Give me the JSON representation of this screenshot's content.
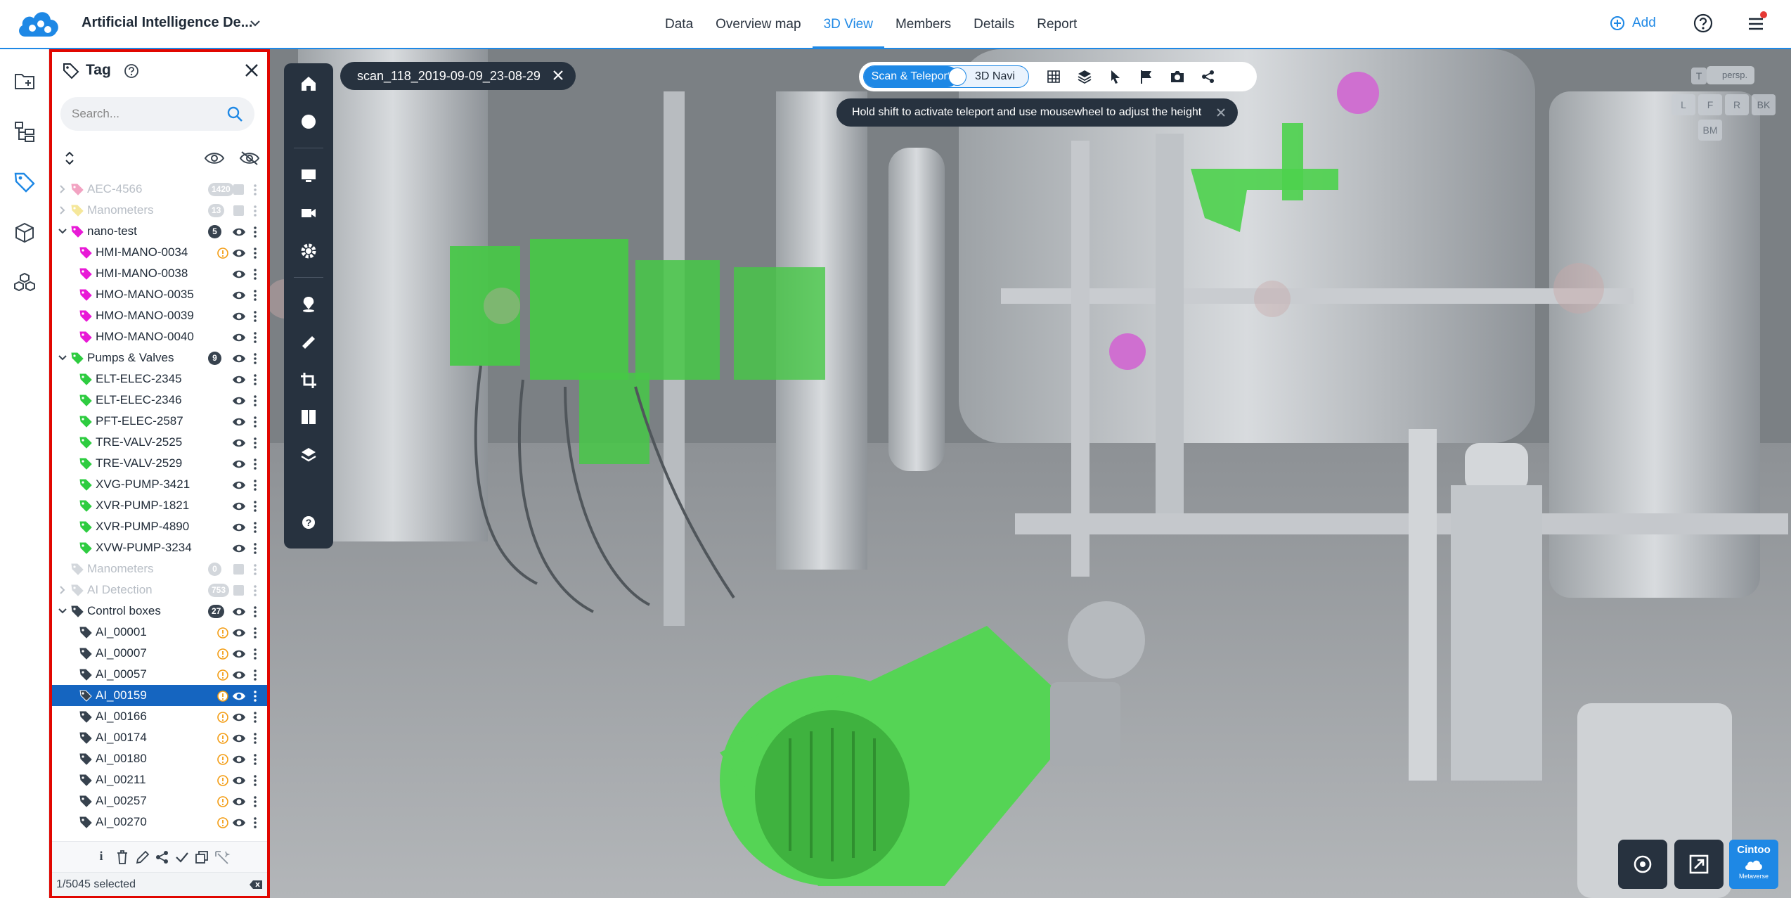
{
  "header": {
    "project_title": "Artificial Intelligence De...",
    "tabs": [
      {
        "label": "Data"
      },
      {
        "label": "Overview map"
      },
      {
        "label": "3D View"
      },
      {
        "label": "Members"
      },
      {
        "label": "Details"
      },
      {
        "label": "Report"
      }
    ],
    "active_tab": "3D View",
    "add_label": "Add",
    "accent_color": "#1e88e5"
  },
  "rail": {
    "icons": [
      "folder-icon",
      "hierarchy-icon",
      "tag-icon",
      "cube-icon",
      "cubes-icon"
    ]
  },
  "tag_panel": {
    "title": "Tag",
    "search_placeholder": "Search...",
    "highlight_color": "#e10600",
    "rows": [
      {
        "label": "AEC-4566",
        "level": 0,
        "expander": "collapsed",
        "color": "#f2a3c2",
        "badge": "1420",
        "dim": true
      },
      {
        "label": "Manometers",
        "level": 0,
        "expander": "collapsed",
        "color": "#f5e79a",
        "badge": "13",
        "dim": true
      },
      {
        "label": "nano-test",
        "level": 0,
        "expander": "expanded",
        "color": "#e81ad6",
        "badge": "5",
        "eye": true
      },
      {
        "label": "HMI-MANO-0034",
        "level": 1,
        "color": "#e81ad6",
        "warn": true,
        "eye": true
      },
      {
        "label": "HMI-MANO-0038",
        "level": 1,
        "color": "#e81ad6",
        "eye": true
      },
      {
        "label": "HMO-MANO-0035",
        "level": 1,
        "color": "#e81ad6",
        "eye": true
      },
      {
        "label": "HMO-MANO-0039",
        "level": 1,
        "color": "#e81ad6",
        "eye": true
      },
      {
        "label": "HMO-MANO-0040",
        "level": 1,
        "color": "#e81ad6",
        "eye": true
      },
      {
        "label": "Pumps & Valves",
        "level": 0,
        "expander": "expanded",
        "color": "#2ecc40",
        "badge": "9",
        "eye": true
      },
      {
        "label": "ELT-ELEC-2345",
        "level": 1,
        "color": "#2ecc40",
        "eye": true
      },
      {
        "label": "ELT-ELEC-2346",
        "level": 1,
        "color": "#2ecc40",
        "eye": true
      },
      {
        "label": "PFT-ELEC-2587",
        "level": 1,
        "color": "#2ecc40",
        "eye": true
      },
      {
        "label": "TRE-VALV-2525",
        "level": 1,
        "color": "#2ecc40",
        "eye": true
      },
      {
        "label": "TRE-VALV-2529",
        "level": 1,
        "color": "#2ecc40",
        "eye": true
      },
      {
        "label": "XVG-PUMP-3421",
        "level": 1,
        "color": "#2ecc40",
        "eye": true
      },
      {
        "label": "XVR-PUMP-1821",
        "level": 1,
        "color": "#2ecc40",
        "eye": true
      },
      {
        "label": "XVR-PUMP-4890",
        "level": 1,
        "color": "#2ecc40",
        "eye": true
      },
      {
        "label": "XVW-PUMP-3234",
        "level": 1,
        "color": "#2ecc40",
        "eye": true
      },
      {
        "label": "Manometers",
        "level": 0,
        "expander": "none",
        "color": "#d3d7dc",
        "badge": "0",
        "dim": true
      },
      {
        "label": "AI Detection",
        "level": 0,
        "expander": "collapsed",
        "color": "#d3d7dc",
        "badge": "753",
        "dim": true
      },
      {
        "label": "Control boxes",
        "level": 0,
        "expander": "expanded",
        "color": "#37424e",
        "badge": "27",
        "eye": true
      },
      {
        "label": "AI_00001",
        "level": 1,
        "color": "#37424e",
        "warn": true,
        "eye": true
      },
      {
        "label": "AI_00007",
        "level": 1,
        "color": "#37424e",
        "warn": true,
        "eye": true
      },
      {
        "label": "AI_00057",
        "level": 1,
        "color": "#37424e",
        "warn": true,
        "eye": true
      },
      {
        "label": "AI_00159",
        "level": 1,
        "color": "#37424e",
        "warn": true,
        "eye": true,
        "selected": true
      },
      {
        "label": "AI_00166",
        "level": 1,
        "color": "#37424e",
        "warn": true,
        "eye": true
      },
      {
        "label": "AI_00174",
        "level": 1,
        "color": "#37424e",
        "warn": true,
        "eye": true
      },
      {
        "label": "AI_00180",
        "level": 1,
        "color": "#37424e",
        "warn": true,
        "eye": true
      },
      {
        "label": "AI_00211",
        "level": 1,
        "color": "#37424e",
        "warn": true,
        "eye": true
      },
      {
        "label": "AI_00257",
        "level": 1,
        "color": "#37424e",
        "warn": true,
        "eye": true
      },
      {
        "label": "AI_00270",
        "level": 1,
        "color": "#37424e",
        "warn": true,
        "eye": true
      }
    ],
    "bottom_actions": [
      "info-icon",
      "trash-icon",
      "edit-icon",
      "share-icon",
      "check-icon",
      "copy-icon",
      "ai-magic-icon"
    ],
    "status": "1/5045 selected"
  },
  "viewer": {
    "scan_name": "scan_118_2019-09-09_23-08-29",
    "toolbar_icons": [
      "home-icon",
      "sphere-icon",
      "monitor-icon",
      "camera-icon",
      "settings-icon",
      "location-icon",
      "measure-icon",
      "crop-icon",
      "section-icon",
      "export-icon",
      "help-icon"
    ],
    "nav_modes": {
      "on": "Scan & Teleport",
      "off": "3D Navi"
    },
    "nav_tools": [
      "grid-icon",
      "layers-icon",
      "pointer-icon",
      "flag-icon",
      "camera-icon",
      "share-icon"
    ],
    "hint": "Hold shift to activate teleport and use mousewheel to adjust the height",
    "view_cube": {
      "projection": "persp.",
      "faces": [
        "T",
        "L",
        "F",
        "R",
        "BK",
        "BM"
      ]
    },
    "bottom_buttons": [
      "reset-view-icon",
      "fullscreen-icon"
    ],
    "brand": {
      "name": "Cintoo",
      "sub": "Metaverse"
    }
  }
}
